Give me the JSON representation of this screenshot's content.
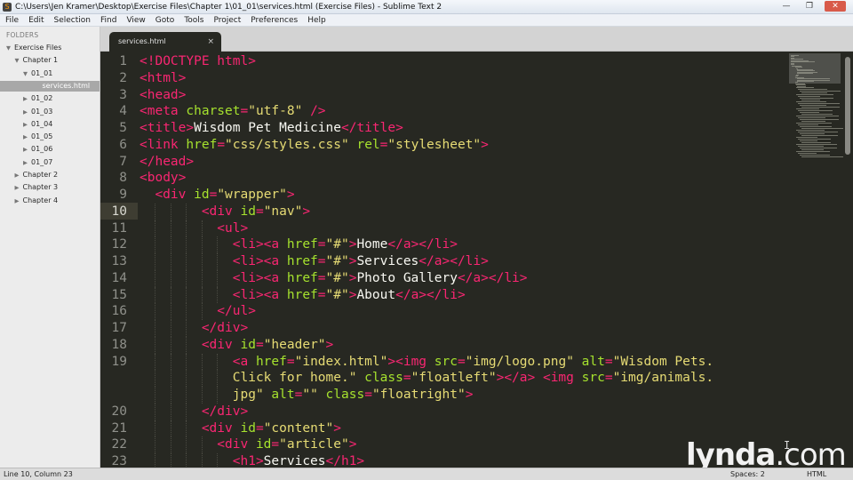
{
  "window": {
    "title": "C:\\Users\\Jen Kramer\\Desktop\\Exercise Files\\Chapter 1\\01_01\\services.html (Exercise Files) - Sublime Text 2",
    "minimize": "—",
    "maximize": "❐",
    "close": "✕"
  },
  "menu": [
    "File",
    "Edit",
    "Selection",
    "Find",
    "View",
    "Goto",
    "Tools",
    "Project",
    "Preferences",
    "Help"
  ],
  "sidebar": {
    "heading": "FOLDERS",
    "tree": [
      {
        "label": "Exercise Files",
        "expanded": true,
        "depth": 0
      },
      {
        "label": "Chapter 1",
        "expanded": true,
        "depth": 1
      },
      {
        "label": "01_01",
        "expanded": true,
        "depth": 2
      },
      {
        "label": "services.html",
        "file": true,
        "selected": true,
        "depth": 3
      },
      {
        "label": "01_02",
        "expanded": false,
        "depth": 2
      },
      {
        "label": "01_03",
        "expanded": false,
        "depth": 2
      },
      {
        "label": "01_04",
        "expanded": false,
        "depth": 2
      },
      {
        "label": "01_05",
        "expanded": false,
        "depth": 2
      },
      {
        "label": "01_06",
        "expanded": false,
        "depth": 2
      },
      {
        "label": "01_07",
        "expanded": false,
        "depth": 2
      },
      {
        "label": "Chapter 2",
        "expanded": false,
        "depth": 1
      },
      {
        "label": "Chapter 3",
        "expanded": false,
        "depth": 1
      },
      {
        "label": "Chapter 4",
        "expanded": false,
        "depth": 1
      }
    ]
  },
  "tab": {
    "label": "services.html",
    "close": "×"
  },
  "editor": {
    "current_line": "10",
    "lines": [
      {
        "num": "1",
        "indent": 0,
        "tokens": [
          [
            "tag",
            "<!DOCTYPE html>"
          ]
        ]
      },
      {
        "num": "2",
        "indent": 0,
        "tokens": [
          [
            "tag",
            "<html>"
          ]
        ]
      },
      {
        "num": "3",
        "indent": 0,
        "tokens": [
          [
            "tag",
            "<head>"
          ]
        ]
      },
      {
        "num": "4",
        "indent": 0,
        "tokens": [
          [
            "tag",
            "<meta "
          ],
          [
            "attr",
            "charset"
          ],
          [
            "tag",
            "="
          ],
          [
            "str",
            "\"utf-8\""
          ],
          [
            "tag",
            " />"
          ]
        ]
      },
      {
        "num": "5",
        "indent": 0,
        "tokens": [
          [
            "tag",
            "<title>"
          ],
          [
            "text",
            "Wisdom Pet Medicine"
          ],
          [
            "tag",
            "</title>"
          ]
        ]
      },
      {
        "num": "6",
        "indent": 0,
        "tokens": [
          [
            "tag",
            "<link "
          ],
          [
            "attr",
            "href"
          ],
          [
            "tag",
            "="
          ],
          [
            "str",
            "\"css/styles.css\""
          ],
          [
            "tag",
            " "
          ],
          [
            "attr",
            "rel"
          ],
          [
            "tag",
            "="
          ],
          [
            "str",
            "\"stylesheet\""
          ],
          [
            "tag",
            ">"
          ]
        ]
      },
      {
        "num": "7",
        "indent": 0,
        "tokens": [
          [
            "tag",
            "</head>"
          ]
        ]
      },
      {
        "num": "8",
        "indent": 0,
        "tokens": [
          [
            "tag",
            "<body>"
          ]
        ]
      },
      {
        "num": "9",
        "indent": 1,
        "tokens": [
          [
            "tag",
            "<div "
          ],
          [
            "attr",
            "id"
          ],
          [
            "tag",
            "="
          ],
          [
            "str",
            "\"wrapper\""
          ],
          [
            "tag",
            ">"
          ]
        ]
      },
      {
        "num": "10",
        "indent": 4,
        "tokens": [
          [
            "tag",
            "<div "
          ],
          [
            "attr",
            "id"
          ],
          [
            "tag",
            "="
          ],
          [
            "str",
            "\"nav\""
          ],
          [
            "tag",
            ">"
          ]
        ]
      },
      {
        "num": "11",
        "indent": 5,
        "tokens": [
          [
            "tag",
            "<ul>"
          ]
        ]
      },
      {
        "num": "12",
        "indent": 6,
        "tokens": [
          [
            "tag",
            "<li><a "
          ],
          [
            "attr",
            "href"
          ],
          [
            "tag",
            "="
          ],
          [
            "str",
            "\"#\""
          ],
          [
            "tag",
            ">"
          ],
          [
            "text",
            "Home"
          ],
          [
            "tag",
            "</a></li>"
          ]
        ]
      },
      {
        "num": "13",
        "indent": 6,
        "tokens": [
          [
            "tag",
            "<li><a "
          ],
          [
            "attr",
            "href"
          ],
          [
            "tag",
            "="
          ],
          [
            "str",
            "\"#\""
          ],
          [
            "tag",
            ">"
          ],
          [
            "text",
            "Services"
          ],
          [
            "tag",
            "</a></li>"
          ]
        ]
      },
      {
        "num": "14",
        "indent": 6,
        "tokens": [
          [
            "tag",
            "<li><a "
          ],
          [
            "attr",
            "href"
          ],
          [
            "tag",
            "="
          ],
          [
            "str",
            "\"#\""
          ],
          [
            "tag",
            ">"
          ],
          [
            "text",
            "Photo Gallery"
          ],
          [
            "tag",
            "</a></li>"
          ]
        ]
      },
      {
        "num": "15",
        "indent": 6,
        "tokens": [
          [
            "tag",
            "<li><a "
          ],
          [
            "attr",
            "href"
          ],
          [
            "tag",
            "="
          ],
          [
            "str",
            "\"#\""
          ],
          [
            "tag",
            ">"
          ],
          [
            "text",
            "About"
          ],
          [
            "tag",
            "</a></li>"
          ]
        ]
      },
      {
        "num": "16",
        "indent": 5,
        "tokens": [
          [
            "tag",
            "</ul>"
          ]
        ]
      },
      {
        "num": "17",
        "indent": 4,
        "tokens": [
          [
            "tag",
            "</div>"
          ]
        ]
      },
      {
        "num": "18",
        "indent": 4,
        "tokens": [
          [
            "tag",
            "<div "
          ],
          [
            "attr",
            "id"
          ],
          [
            "tag",
            "="
          ],
          [
            "str",
            "\"header\""
          ],
          [
            "tag",
            ">"
          ]
        ]
      },
      {
        "num": "19",
        "indent": 6,
        "tokens": [
          [
            "tag",
            "<a "
          ],
          [
            "attr",
            "href"
          ],
          [
            "tag",
            "="
          ],
          [
            "str",
            "\"index.html\""
          ],
          [
            "tag",
            "><img "
          ],
          [
            "attr",
            "src"
          ],
          [
            "tag",
            "="
          ],
          [
            "str",
            "\"img/logo.png\""
          ],
          [
            "tag",
            " "
          ],
          [
            "attr",
            "alt"
          ],
          [
            "tag",
            "="
          ],
          [
            "str",
            "\"Wisdom Pets."
          ]
        ]
      },
      {
        "num": "",
        "indent": 6,
        "tokens": [
          [
            "str",
            "Click for home.\""
          ],
          [
            "tag",
            " "
          ],
          [
            "attr",
            "class"
          ],
          [
            "tag",
            "="
          ],
          [
            "str",
            "\"floatleft\""
          ],
          [
            "tag",
            "></a> <img "
          ],
          [
            "attr",
            "src"
          ],
          [
            "tag",
            "="
          ],
          [
            "str",
            "\"img/animals."
          ]
        ]
      },
      {
        "num": "",
        "indent": 6,
        "tokens": [
          [
            "str",
            "jpg\""
          ],
          [
            "tag",
            " "
          ],
          [
            "attr",
            "alt"
          ],
          [
            "tag",
            "="
          ],
          [
            "str",
            "\"\""
          ],
          [
            "tag",
            " "
          ],
          [
            "attr",
            "class"
          ],
          [
            "tag",
            "="
          ],
          [
            "str",
            "\"floatright\""
          ],
          [
            "tag",
            ">"
          ]
        ]
      },
      {
        "num": "20",
        "indent": 4,
        "tokens": [
          [
            "tag",
            "</div>"
          ]
        ]
      },
      {
        "num": "21",
        "indent": 4,
        "tokens": [
          [
            "tag",
            "<div "
          ],
          [
            "attr",
            "id"
          ],
          [
            "tag",
            "="
          ],
          [
            "str",
            "\"content\""
          ],
          [
            "tag",
            ">"
          ]
        ]
      },
      {
        "num": "22",
        "indent": 5,
        "tokens": [
          [
            "tag",
            "<div "
          ],
          [
            "attr",
            "id"
          ],
          [
            "tag",
            "="
          ],
          [
            "str",
            "\"article\""
          ],
          [
            "tag",
            ">"
          ]
        ]
      },
      {
        "num": "23",
        "indent": 6,
        "tokens": [
          [
            "tag",
            "<h1>"
          ],
          [
            "text",
            "Services"
          ],
          [
            "tag",
            "</h1>"
          ]
        ]
      }
    ]
  },
  "colors": {
    "tag": "#f92672",
    "attr": "#a6e22e",
    "str": "#e6db74",
    "text": "#f8f8f2",
    "background": "#272822"
  },
  "watermark": {
    "brand": "lynda",
    "dot": ".",
    "tld": "com"
  },
  "status": {
    "position": "Line 10, Column 23",
    "spaces": "Spaces: 2",
    "syntax": "HTML"
  }
}
